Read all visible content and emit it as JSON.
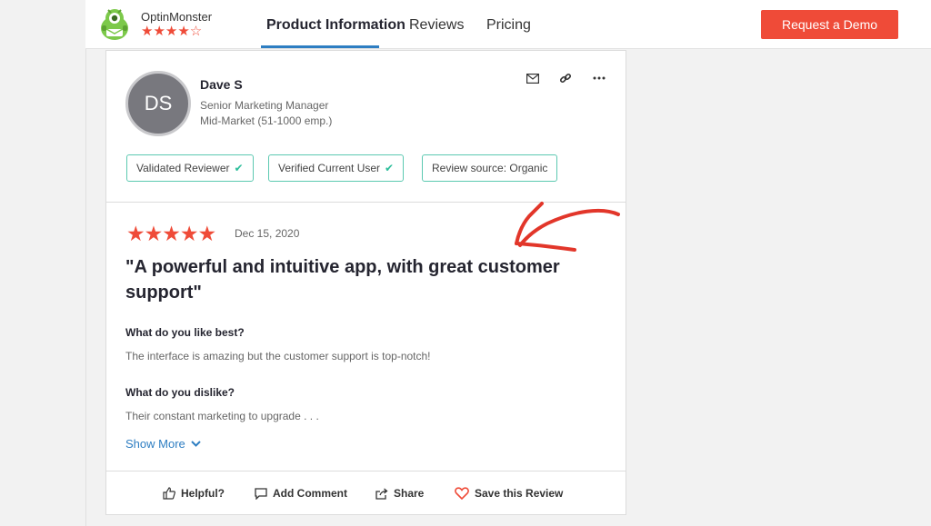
{
  "header": {
    "brand_name": "OptinMonster",
    "brand_stars": "★★★★",
    "brand_star_empty": "☆",
    "rating_level": 4,
    "nav": {
      "product": "Product Information",
      "reviews": "Reviews",
      "pricing": "Pricing"
    },
    "demo_button": "Request a Demo"
  },
  "review": {
    "avatar_initials": "DS",
    "reviewer_name": "Dave S",
    "reviewer_title": "Senior Marketing Manager",
    "reviewer_segment": "Mid-Market (51-1000 emp.)",
    "icons": [
      "mail-icon",
      "link-icon",
      "more-icon"
    ],
    "badges": [
      {
        "label": "Validated Reviewer",
        "check": "✔"
      },
      {
        "label": "Verified Current User",
        "check": "✔"
      },
      {
        "label": "Review source: Organic"
      }
    ],
    "stars": "★★★★★",
    "rating": 5,
    "date": "Dec 15, 2020",
    "headline": "\"A powerful and intuitive app, with great customer support\"",
    "q1": "What do you like best?",
    "a1": "The interface is amazing but the customer support is top-notch!",
    "q2": "What do you dislike?",
    "a2": "Their constant marketing to upgrade . . .",
    "show_more": "Show More"
  },
  "footer": {
    "helpful": "Helpful?",
    "add_comment": "Add Comment",
    "share": "Share",
    "save": "Save this Review"
  },
  "colors": {
    "accent_red": "#ef4b38",
    "link_blue": "#2e7ec2",
    "badge_teal": "#5cc9b1"
  }
}
